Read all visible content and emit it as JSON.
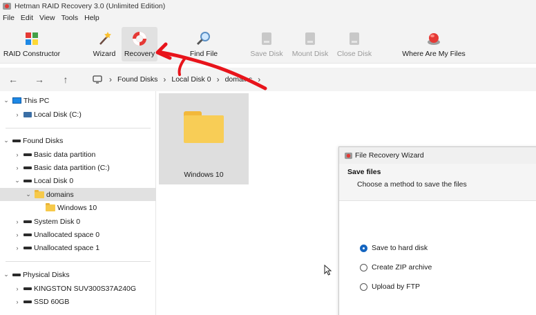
{
  "window": {
    "title": "Hetman RAID Recovery 3.0 (Unlimited Edition)"
  },
  "menu": [
    "File",
    "Edit",
    "View",
    "Tools",
    "Help"
  ],
  "toolbar": {
    "raid_constructor": "RAID Constructor",
    "wizard": "Wizard",
    "recovery": "Recovery",
    "find_file": "Find File",
    "save_disk": "Save Disk",
    "mount_disk": "Mount Disk",
    "close_disk": "Close Disk",
    "where_are_my_files": "Where Are My Files"
  },
  "breadcrumb": [
    "Found Disks",
    "Local Disk 0",
    "domains"
  ],
  "sidebar": {
    "this_pc": "This PC",
    "local_disk_c": "Local Disk (C:)",
    "found_disks": "Found Disks",
    "basic_data_partition": "Basic data partition",
    "basic_data_partition_c": "Basic data partition (C:)",
    "local_disk_0": "Local Disk 0",
    "domains": "domains",
    "windows_10": "Windows 10",
    "system_disk_0": "System Disk 0",
    "unallocated_0": "Unallocated space 0",
    "unallocated_1": "Unallocated space 1",
    "physical_disks": "Physical Disks",
    "kingston": "KINGSTON SUV300S37A240G",
    "ssd_60gb": "SSD 60GB"
  },
  "content": {
    "folder_label": "Windows 10"
  },
  "wizard": {
    "title": "File Recovery Wizard",
    "heading": "Save files",
    "subheading": "Choose a method to save the files",
    "options": [
      "Save to hard disk",
      "Create ZIP archive",
      "Upload by FTP"
    ],
    "selected_option": "Save to hard disk"
  },
  "colors": {
    "annotation_arrow": "#e8141b",
    "accent": "#1565c0",
    "folder": "#f8cd56"
  }
}
